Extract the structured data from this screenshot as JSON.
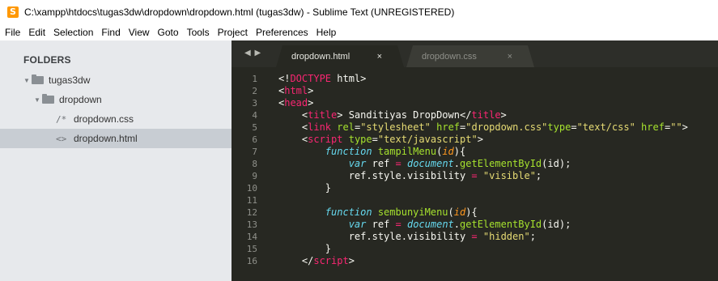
{
  "window": {
    "title": "C:\\xampp\\htdocs\\tugas3dw\\dropdown\\dropdown.html (tugas3dw) - Sublime Text (UNREGISTERED)"
  },
  "icons": {
    "app_icon_glyph": "S"
  },
  "menu": [
    "File",
    "Edit",
    "Selection",
    "Find",
    "View",
    "Goto",
    "Tools",
    "Project",
    "Preferences",
    "Help"
  ],
  "sidebar": {
    "heading": "FOLDERS",
    "items": [
      {
        "label": "tugas3dw",
        "type": "folder"
      },
      {
        "label": "dropdown",
        "type": "folder"
      },
      {
        "label": "dropdown.css",
        "type": "file",
        "glyph": "/*"
      },
      {
        "label": "dropdown.html",
        "type": "file",
        "glyph": "<>"
      }
    ],
    "selected": "dropdown.html"
  },
  "tabs": [
    {
      "label": "dropdown.html",
      "active": true
    },
    {
      "label": "dropdown.css",
      "active": false
    }
  ],
  "tab_nav_glyph": "◀ ▶",
  "tab_close_glyph": "×",
  "line_numbers": [
    "1",
    "2",
    "3",
    "4",
    "5",
    "6",
    "7",
    "8",
    "9",
    "10",
    "11",
    "12",
    "13",
    "14",
    "15",
    "16"
  ],
  "code_lines": [
    [
      {
        "c": "pl",
        "t": "<!"
      },
      {
        "c": "t",
        "t": "DOCTYPE"
      },
      {
        "c": "pl",
        "t": " html>"
      }
    ],
    [
      {
        "c": "pl",
        "t": "<"
      },
      {
        "c": "t",
        "t": "html"
      },
      {
        "c": "pl",
        "t": ">"
      }
    ],
    [
      {
        "c": "pl",
        "t": "<"
      },
      {
        "c": "t",
        "t": "head"
      },
      {
        "c": "pl",
        "t": ">"
      }
    ],
    [
      {
        "c": "pl",
        "t": "    <"
      },
      {
        "c": "t",
        "t": "title"
      },
      {
        "c": "pl",
        "t": "> Sanditiyas DropDown</"
      },
      {
        "c": "t",
        "t": "title"
      },
      {
        "c": "pl",
        "t": ">"
      }
    ],
    [
      {
        "c": "pl",
        "t": "    <"
      },
      {
        "c": "t",
        "t": "link"
      },
      {
        "c": "pl",
        "t": " "
      },
      {
        "c": "a",
        "t": "rel"
      },
      {
        "c": "pl",
        "t": "="
      },
      {
        "c": "s",
        "t": "\"stylesheet\""
      },
      {
        "c": "pl",
        "t": " "
      },
      {
        "c": "a",
        "t": "href"
      },
      {
        "c": "pl",
        "t": "="
      },
      {
        "c": "s",
        "t": "\"dropdown.css\""
      },
      {
        "c": "a",
        "t": "type"
      },
      {
        "c": "pl",
        "t": "="
      },
      {
        "c": "s",
        "t": "\"text/css\""
      },
      {
        "c": "pl",
        "t": " "
      },
      {
        "c": "a",
        "t": "href"
      },
      {
        "c": "pl",
        "t": "="
      },
      {
        "c": "s",
        "t": "\"\""
      },
      {
        "c": "pl",
        "t": ">"
      }
    ],
    [
      {
        "c": "pl",
        "t": "    <"
      },
      {
        "c": "t",
        "t": "script"
      },
      {
        "c": "pl",
        "t": " "
      },
      {
        "c": "a",
        "t": "type"
      },
      {
        "c": "pl",
        "t": "="
      },
      {
        "c": "s",
        "t": "\"text/javascript\""
      },
      {
        "c": "pl",
        "t": ">"
      }
    ],
    [
      {
        "c": "pl",
        "t": "        "
      },
      {
        "c": "k",
        "t": "function"
      },
      {
        "c": "pl",
        "t": " "
      },
      {
        "c": "f",
        "t": "tampilMenu"
      },
      {
        "c": "pl",
        "t": "("
      },
      {
        "c": "p",
        "t": "id"
      },
      {
        "c": "pl",
        "t": "){"
      }
    ],
    [
      {
        "c": "pl",
        "t": "            "
      },
      {
        "c": "k",
        "t": "var"
      },
      {
        "c": "pl",
        "t": " ref "
      },
      {
        "c": "t",
        "t": "="
      },
      {
        "c": "pl",
        "t": " "
      },
      {
        "c": "k",
        "t": "document"
      },
      {
        "c": "pl",
        "t": "."
      },
      {
        "c": "f",
        "t": "getElementById"
      },
      {
        "c": "pl",
        "t": "(id);"
      }
    ],
    [
      {
        "c": "pl",
        "t": "            ref.style.visibility "
      },
      {
        "c": "t",
        "t": "="
      },
      {
        "c": "pl",
        "t": " "
      },
      {
        "c": "s",
        "t": "\"visible\""
      },
      {
        "c": "pl",
        "t": ";"
      }
    ],
    [
      {
        "c": "pl",
        "t": "        }"
      }
    ],
    [
      {
        "c": "pl",
        "t": ""
      }
    ],
    [
      {
        "c": "pl",
        "t": "        "
      },
      {
        "c": "k",
        "t": "function"
      },
      {
        "c": "pl",
        "t": " "
      },
      {
        "c": "f",
        "t": "sembunyiMenu"
      },
      {
        "c": "pl",
        "t": "("
      },
      {
        "c": "p",
        "t": "id"
      },
      {
        "c": "pl",
        "t": "){"
      }
    ],
    [
      {
        "c": "pl",
        "t": "            "
      },
      {
        "c": "k",
        "t": "var"
      },
      {
        "c": "pl",
        "t": " ref "
      },
      {
        "c": "t",
        "t": "="
      },
      {
        "c": "pl",
        "t": " "
      },
      {
        "c": "k",
        "t": "document"
      },
      {
        "c": "pl",
        "t": "."
      },
      {
        "c": "f",
        "t": "getElementById"
      },
      {
        "c": "pl",
        "t": "(id);"
      }
    ],
    [
      {
        "c": "pl",
        "t": "            ref.style.visibility "
      },
      {
        "c": "t",
        "t": "="
      },
      {
        "c": "pl",
        "t": " "
      },
      {
        "c": "s",
        "t": "\"hidden\""
      },
      {
        "c": "pl",
        "t": ";"
      }
    ],
    [
      {
        "c": "pl",
        "t": "        }"
      }
    ],
    [
      {
        "c": "pl",
        "t": "    </"
      },
      {
        "c": "t",
        "t": "script"
      },
      {
        "c": "pl",
        "t": ">"
      }
    ]
  ]
}
